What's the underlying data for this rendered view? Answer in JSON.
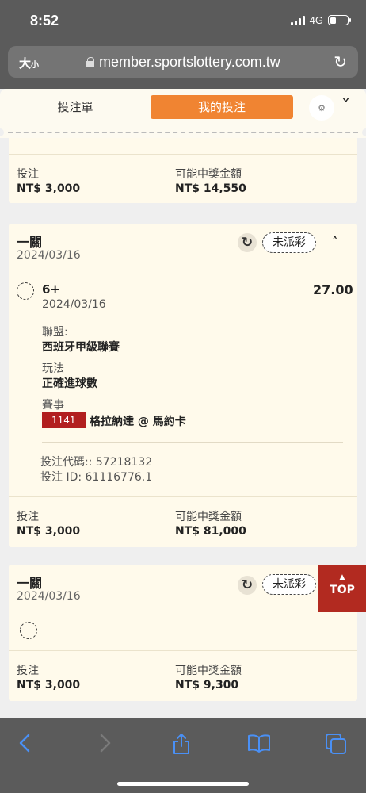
{
  "status_bar": {
    "time": "8:52",
    "network": "4G"
  },
  "browser": {
    "aa_large": "大",
    "aa_small": "小",
    "url": "member.sportslottery.com.tw"
  },
  "tabs": {
    "orders": "投注單",
    "my_bets": "我的投注"
  },
  "card0": {
    "stake_label": "投注",
    "stake_value": "NT$ 3,000",
    "payout_label": "可能中獎金額",
    "payout_value": "NT$ 14,550"
  },
  "card1": {
    "title": "一關",
    "date": "2024/03/16",
    "status": "未派彩",
    "selection": "6+",
    "odds": "27.00",
    "selection_date": "2024/03/16",
    "league_label": "聯盟:",
    "league_value": "西班牙甲級聯賽",
    "market_label": "玩法",
    "market_value": "正確進球數",
    "event_label": "賽事",
    "match_id": "1141",
    "match_name": "格拉納達 @ 馬約卡",
    "bet_code": "投注代碼:: 57218132",
    "bet_id": "投注 ID: 61116776.1",
    "stake_label": "投注",
    "stake_value": "NT$ 3,000",
    "payout_label": "可能中獎金額",
    "payout_value": "NT$ 81,000"
  },
  "card2": {
    "title": "一關",
    "date": "2024/03/16",
    "status": "未派彩",
    "stake_label": "投注",
    "stake_value": "NT$ 3,000",
    "payout_label": "可能中獎金額",
    "payout_value": "NT$ 9,300"
  },
  "top_button": "TOP",
  "colors": {
    "accent": "#f08432",
    "top_button": "#b22a20",
    "match_badge": "#b21f1f",
    "card_bg": "#fffaeb",
    "ios_blue": "#4a90f5"
  }
}
